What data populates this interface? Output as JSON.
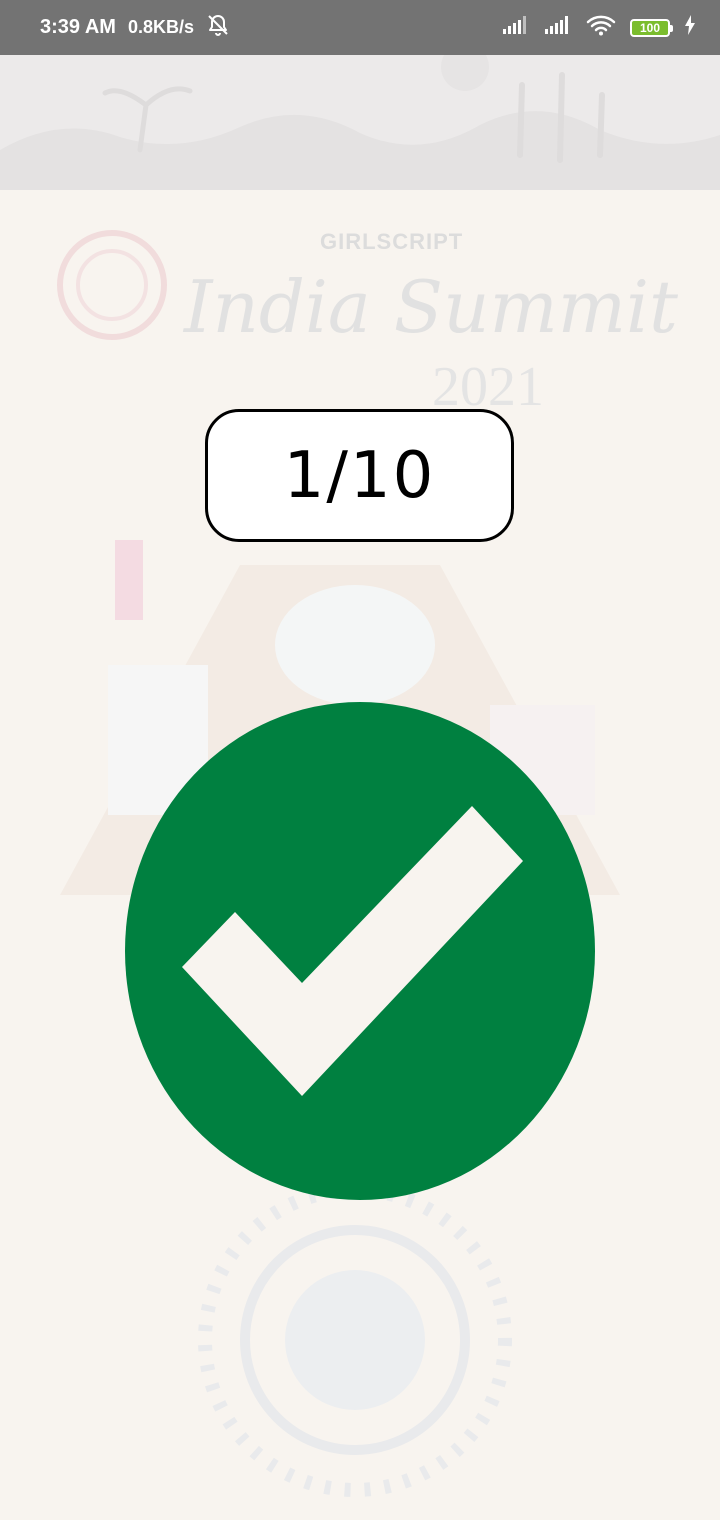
{
  "status_bar": {
    "time": "3:39 AM",
    "network_speed": "0.8KB/s",
    "battery_level": "100",
    "icons": [
      "alarm-off-icon",
      "signal-icon",
      "signal-icon",
      "wifi-icon",
      "battery-icon",
      "charging-icon"
    ]
  },
  "background": {
    "brand": "GIRLSCRIPT",
    "title": "India Summit",
    "year": "2021"
  },
  "quiz": {
    "progress": "1/10",
    "result_icon": "check-circle-icon"
  },
  "colors": {
    "status_bar": "#737373",
    "page_background": "#f8f4ef",
    "success_green": "#008040",
    "check_mark": "#f8f4ef",
    "battery_fill": "#7bbd2e"
  }
}
